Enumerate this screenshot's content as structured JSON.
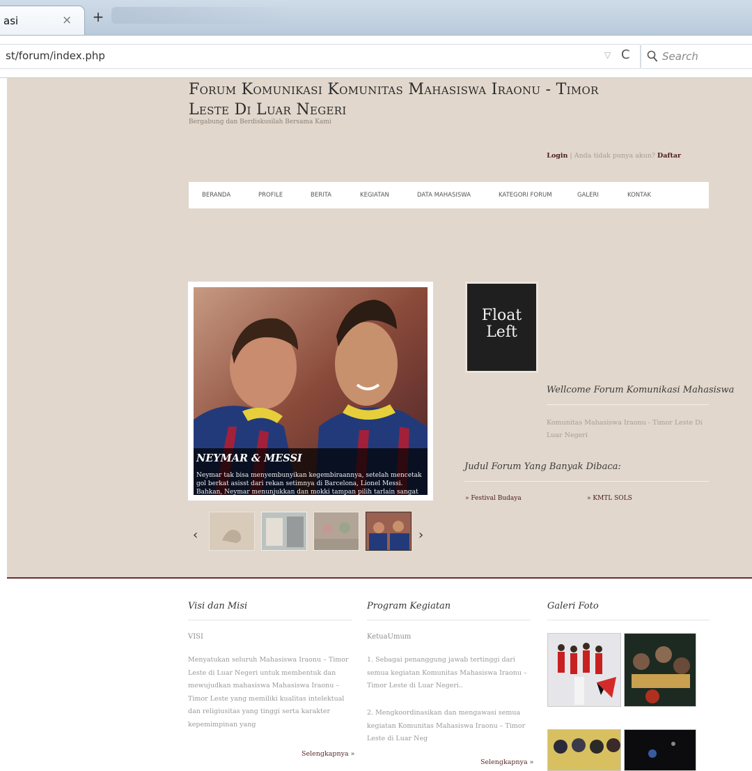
{
  "browser": {
    "tab_title": "asi",
    "tab_close": "×",
    "new_tab": "+",
    "url": "st/forum/index.php",
    "url_dropdown": "▽",
    "reload": "C",
    "search_placeholder": "Search"
  },
  "site": {
    "title": "Forum Komunikasi Komunitas Mahasiswa Iraonu - Timor Leste Di Luar Negeri",
    "tagline": "Bergabung dan Berdiskusilah Bersama Kami",
    "login": {
      "login_label": "Login",
      "separator": " | ",
      "prompt": "Anda tidak punya akun? ",
      "register_label": "Daftar"
    }
  },
  "menu": {
    "items": [
      "BERANDA",
      "PROFILE",
      "BERITA",
      "KEGIATAN",
      "DATA MAHASISWA",
      "KATEGORI FORUM",
      "GALERI",
      "KONTAK"
    ]
  },
  "slider": {
    "caption_title": "NEYMAR & MESSI",
    "caption_text": "Neymar tak bisa menyembunyikan kegembiraannya, setelah mencetak gol berkat asisst dari rekan setimnya di Barcelona, Lionel Messi. Bahkan, Neymar menunjukkan dan mokki tampan pilih tarlain sangat dari anaskin kelubah",
    "prev": "‹",
    "next": "›"
  },
  "sidebar": {
    "float_text_1": "Float",
    "float_text_2": "Left",
    "welcome_title": "Wellcome Forum Komunikasi Mahasiswa",
    "welcome_sub": "Komunitas Mahasiswa Iraonu - Timor Leste Di Luar Negeri",
    "popular_title": "Judul Forum Yang Banyak Dibaca:",
    "popular_items": [
      "» Festival Budaya",
      "» KMTL SOLS"
    ]
  },
  "widgets": {
    "visi": {
      "title": "Visi dan Misi",
      "subtitle": "VISI",
      "text": "Menyatukan seluruh Mahasiswa Iraonu – Timor Leste di Luar Negeri untuk membentuk dan mewujudkan mahasiswa Mahasiswa Iraonu – Timor Leste yang memiliki kualitas intelektual dan religiusitas yang tinggi serta karakter kepemimpinan yang",
      "more": "Selengkapnya »"
    },
    "program": {
      "title": "Program Kegiatan",
      "subtitle": "KetuaUmum",
      "point1": "1. Sebagai penanggung jawab tertinggi dari semua kegiatan Komunitas Mahasiswa Iraonu – Timor Leste di Luar Negeri..",
      "point2": "2. Mengkoordinasikan dan mengawasi semua kegiatan Komunitas Mahasiswa Iraonu – Timor Leste di Luar Neg",
      "more": "Selengkapnya »"
    },
    "galeri": {
      "title": "Galeri Foto"
    }
  },
  "colors": {
    "page_bg": "#e1d7cc",
    "accent": "#6b2b32",
    "link": "#4a1b1b"
  }
}
